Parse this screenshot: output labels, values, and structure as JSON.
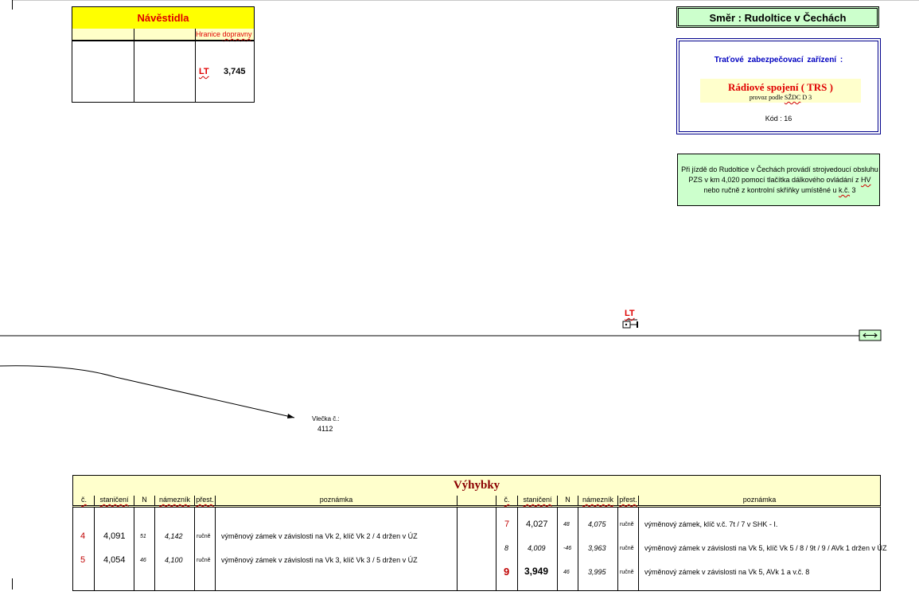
{
  "navestidla": {
    "title": "Návěstidla",
    "sub_label_1": "Hranice",
    "sub_label_2": "dopravny",
    "signal_name": "LT",
    "signal_km": "3,745"
  },
  "smer": {
    "label": "Směr  :  Rudoltice v Čechách"
  },
  "zabezpeceni": {
    "title": "Traťové  zabezpečovací  zařízení :",
    "system": "Rádiové spojení  ( TRS )",
    "provoz_prefix": "provoz podle ",
    "provoz_rule": "SŽDC",
    "provoz_suffix": " D 3",
    "kod": "Kód :  16"
  },
  "pzs_note": {
    "line1": "Při jízdě do Rudoltice v Čechách provádí strojvedoucí obsluhu",
    "line2_a": "PZS v km 4,020 pomocí tlačítka dálkového ovládání z ",
    "line2_hv": "HV",
    "line3_a": "nebo ručně z kontrolní skříňky umístěné u ",
    "line3_kc": "k.č.",
    "line3_b": " 3"
  },
  "track": {
    "signal_label": "LT",
    "signal_icon": "level-crossing-signal-icon",
    "end_marker_icon": "double-arrow-icon",
    "siding_label": "Vlečka č.:",
    "siding_number": "4112"
  },
  "vyhybky": {
    "title": "Výhybky",
    "headers": [
      "č.",
      "staničení",
      "N",
      "námezník",
      "přest.",
      "poznámka",
      "č.",
      "staničení",
      "N",
      "námezník",
      "přest.",
      "poznámka"
    ],
    "left_rows": [
      {
        "c": "4",
        "km": "4,091",
        "n": "51",
        "namez": "4,142",
        "prest": "ručně",
        "pozn": "výměnový zámek v závislosti na Vk 2, klíč Vk 2 / 4 držen v ÚZ"
      },
      {
        "c": "5",
        "km": "4,054",
        "n": "46",
        "namez": "4,100",
        "prest": "ručně",
        "pozn": "výměnový zámek v závislosti na Vk 3, klíč Vk 3 / 5 držen v ÚZ"
      }
    ],
    "right_rows": [
      {
        "c": "7",
        "km": "4,027",
        "n": "48",
        "namez": "4,075",
        "prest": "ručně",
        "pozn": "výměnový zámek, klíč v.č. 7t / 7 v SHK - I."
      },
      {
        "c": "8",
        "km": "4,009",
        "n": "-46",
        "namez": "3,963",
        "prest": "ručně",
        "pozn": "výměnový zámek v závislosti na Vk 5, klíč Vk 5 / 8 / 9t / 9 / AVk 1 držen v ÚZ"
      },
      {
        "c": "9",
        "km": "3,949",
        "n": "46",
        "namez": "3,995",
        "prest": "ručně",
        "pozn": "výměnový zámek v závislosti na Vk 5, AVk 1 a v.č. 8"
      }
    ]
  }
}
